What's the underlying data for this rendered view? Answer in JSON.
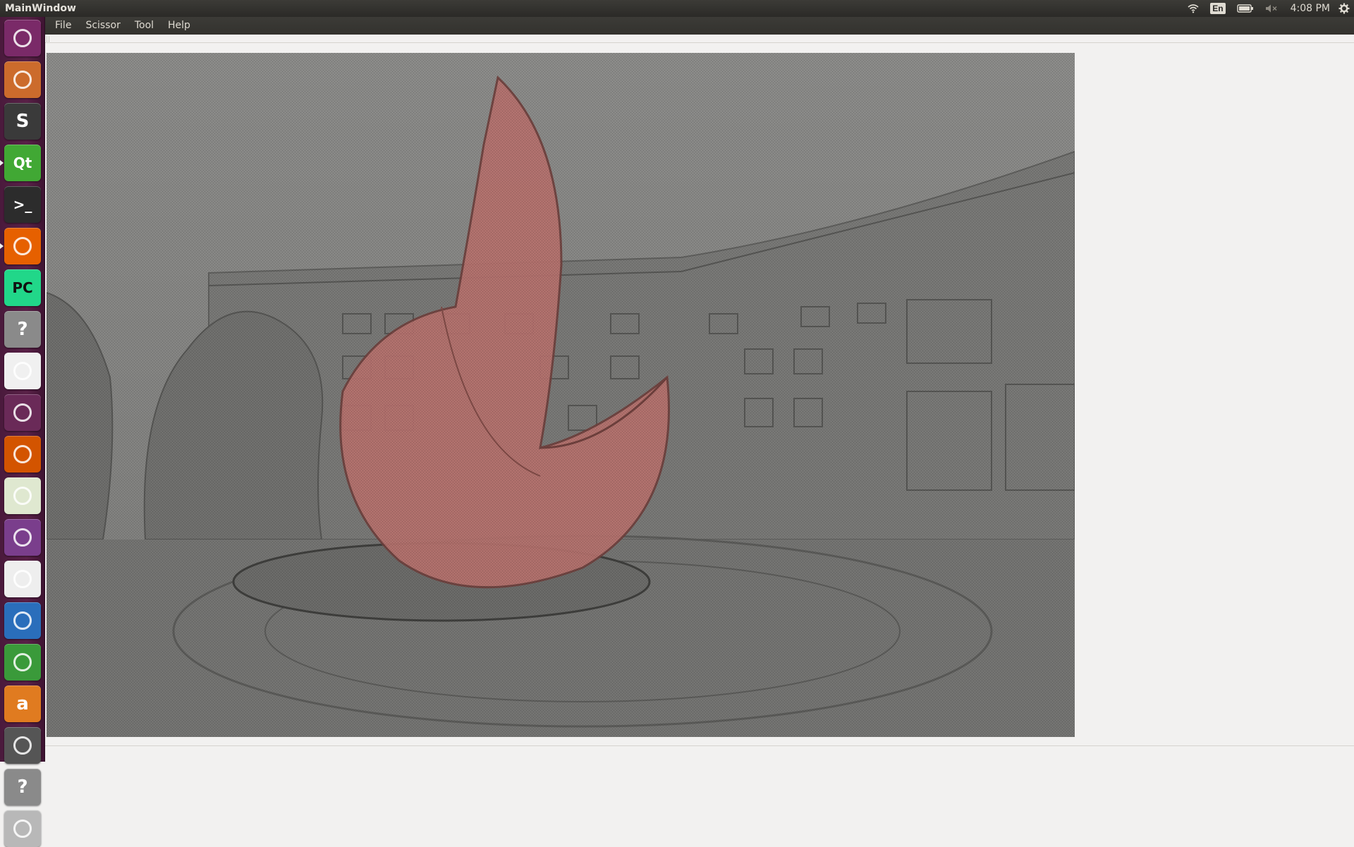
{
  "window": {
    "title": "MainWindow"
  },
  "menu": [
    "File",
    "Scissor",
    "Tool",
    "Help"
  ],
  "panel": {
    "keyboard_layout": "En",
    "clock": "4:08 PM",
    "indicators": [
      "wifi-icon",
      "keyboard-layout-indicator",
      "battery-icon",
      "volume-muted-icon",
      "system-gear-icon"
    ]
  },
  "launcher": {
    "items": [
      {
        "name": "ubuntu-dash-icon",
        "color": "#7a2a68"
      },
      {
        "name": "files-icon",
        "color": "#cc6b2c"
      },
      {
        "name": "sublime-text-icon",
        "color": "#3a3a3a",
        "letter": "S"
      },
      {
        "name": "qt-creator-icon",
        "color": "#41a834",
        "letter": "Qt"
      },
      {
        "name": "terminal-icon",
        "color": "#2c2c2c",
        "letter": ">_"
      },
      {
        "name": "firefox-icon",
        "color": "#e66000"
      },
      {
        "name": "pycharm-icon",
        "color": "#21d789",
        "letter": "PC"
      },
      {
        "name": "unknown-app-icon",
        "color": "#8a8a8a",
        "letter": "?"
      },
      {
        "name": "pdf-viewer-icon",
        "color": "#f0f0f0"
      },
      {
        "name": "window-app-icon",
        "color": "#6a2a58"
      },
      {
        "name": "impress-icon",
        "color": "#d35400"
      },
      {
        "name": "image-viewer-icon",
        "color": "#dfe8d0"
      },
      {
        "name": "remote-desktop-icon",
        "color": "#7a3e8c"
      },
      {
        "name": "text-editor-icon",
        "color": "#eeeeee"
      },
      {
        "name": "writer-icon",
        "color": "#2a6ebb"
      },
      {
        "name": "calc-icon",
        "color": "#3a9a3a"
      },
      {
        "name": "amazon-icon",
        "color": "#e07b20",
        "letter": "a"
      },
      {
        "name": "disk-app-icon",
        "color": "#555555"
      },
      {
        "name": "unknown-app-2-icon",
        "color": "#8a8a8a",
        "letter": "?"
      },
      {
        "name": "trash-icon",
        "color": "#b8b8b8"
      }
    ]
  },
  "canvas": {
    "description_hidden": "",
    "sky_color": "#8d8d8b",
    "sculpture_color": "#b4706c"
  }
}
